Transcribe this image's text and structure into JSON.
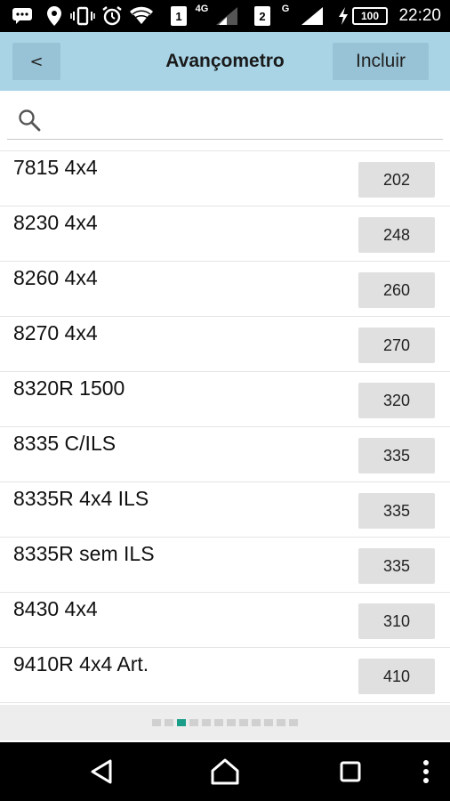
{
  "status_bar": {
    "sim1": "1",
    "sim1_net": "4G",
    "sim2": "2",
    "sim2_net": "G",
    "battery": "100",
    "time": "22:20"
  },
  "header": {
    "back_label": "<",
    "title": "Avançometro",
    "include_label": "Incluir"
  },
  "search": {
    "value": "",
    "placeholder": ""
  },
  "items": [
    {
      "label": "7815 4x4",
      "value": "202"
    },
    {
      "label": "8230 4x4",
      "value": "248"
    },
    {
      "label": "8260 4x4",
      "value": "260"
    },
    {
      "label": "8270 4x4",
      "value": "270"
    },
    {
      "label": "8320R 1500",
      "value": "320"
    },
    {
      "label": "8335 C/ILS",
      "value": "335"
    },
    {
      "label": "8335R 4x4 ILS",
      "value": "335"
    },
    {
      "label": "8335R sem ILS",
      "value": "335"
    },
    {
      "label": "8430 4x4",
      "value": "310"
    },
    {
      "label": "9410R 4x4 Art.",
      "value": "410"
    }
  ],
  "pager": {
    "total_pages": 12,
    "current_page": 3
  },
  "colors": {
    "header_bg": "#a8d4e6",
    "button_bg": "#98c3d6",
    "badge_bg": "#e0e0e0",
    "pager_active": "#1a9e8a"
  }
}
